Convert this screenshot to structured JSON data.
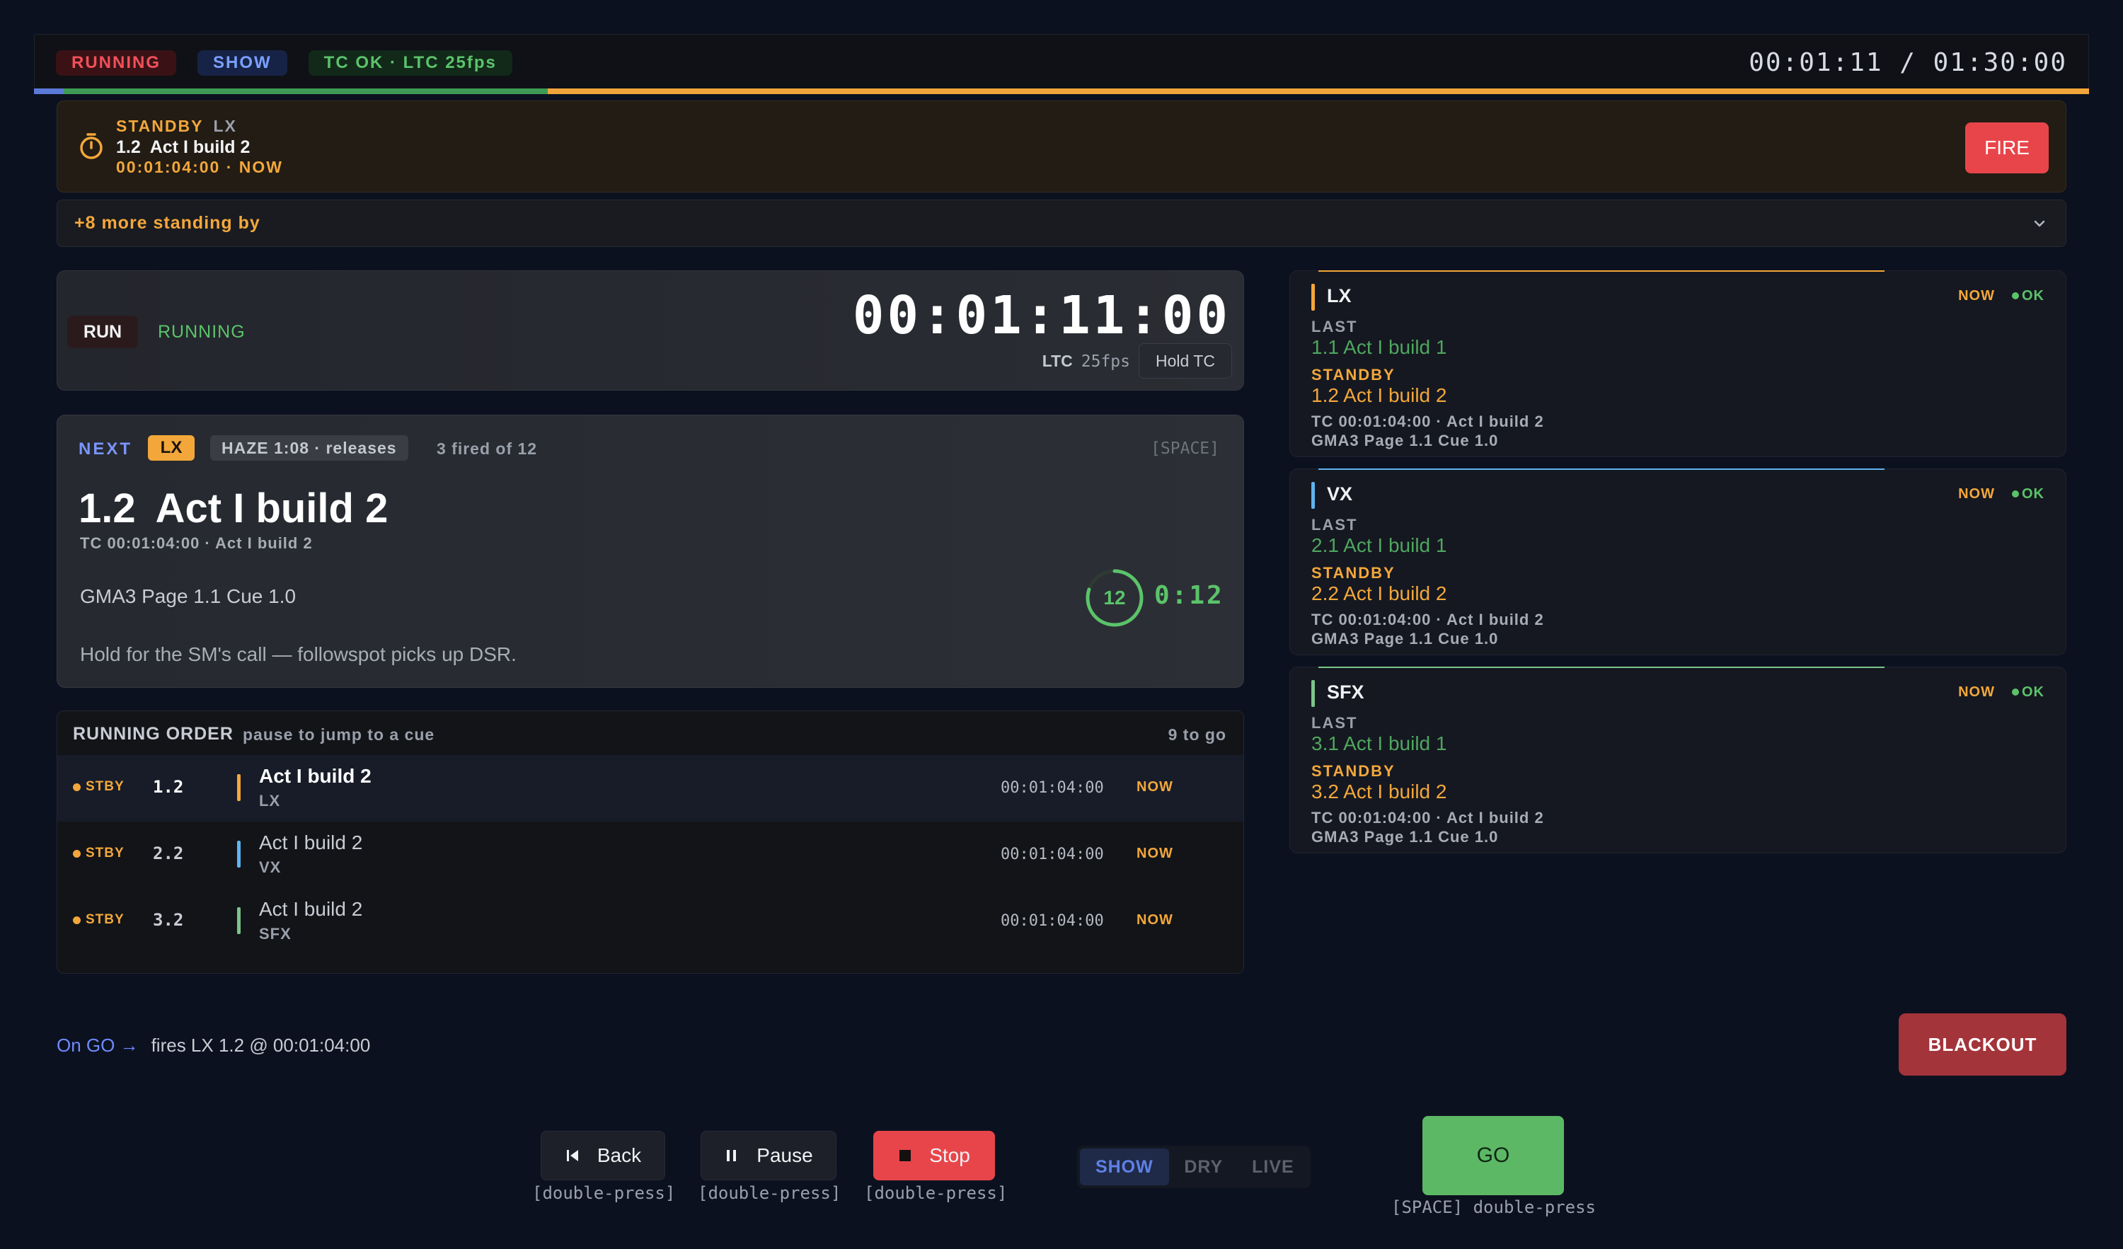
{
  "status_bar": {
    "running": "RUNNING",
    "mode": "SHOW",
    "tc_status": "TC OK · LTC 25fps",
    "elapsed_total": "00:01:11 / 01:30:00"
  },
  "colors": {
    "amber": "#f3a73b",
    "green": "#5bc36a",
    "red": "#e8454a",
    "blue": "#7a95ff",
    "vx": "#5fb3f0",
    "sfx": "#7cc48a"
  },
  "standby": {
    "label": "STANDBY",
    "dept": "LX",
    "cue": "1.2  Act I build 2",
    "time": "00:01:04:00 · NOW",
    "fire_label": "FIRE",
    "icon": "stopwatch-icon"
  },
  "more_standby": {
    "label": "+8 more standing by",
    "icon": "chevron-down-icon"
  },
  "timecode": {
    "run_label": "RUN",
    "status": "RUNNING",
    "tc": "00:01:11:00",
    "ltc_label": "LTC",
    "fps": "25fps",
    "hold_label": "Hold TC"
  },
  "next": {
    "label": "NEXT",
    "dept": "LX",
    "haze": "HAZE 1:08 · releases",
    "fired": "3 fired of 12",
    "shortcut": "[SPACE]",
    "number": "1.2",
    "title": "Act I build 2",
    "tc_line": "TC 00:01:04:00 · Act I build 2",
    "target": "GMA3 Page 1.1 Cue 1.0",
    "note": "Hold for the SM's call — followspot picks up DSR.",
    "countdown_num": "12",
    "countdown_time": "0:12",
    "countdown_fraction": 0.8
  },
  "running_order": {
    "title": "RUNNING ORDER",
    "subtitle": "pause to jump to a cue",
    "remaining": "9 to go",
    "rows": [
      {
        "status": "STBY",
        "num": "1.2",
        "title": "Act I build 2",
        "dept": "LX",
        "tc": "00:01:04:00",
        "when": "NOW",
        "color": "#f3a73b"
      },
      {
        "status": "STBY",
        "num": "2.2",
        "title": "Act I build 2",
        "dept": "VX",
        "tc": "00:01:04:00",
        "when": "NOW",
        "color": "#5fb3f0"
      },
      {
        "status": "STBY",
        "num": "3.2",
        "title": "Act I build 2",
        "dept": "SFX",
        "tc": "00:01:04:00",
        "when": "NOW",
        "color": "#7cc48a"
      }
    ]
  },
  "dept_cards": [
    {
      "name": "LX",
      "now": "NOW",
      "ok": "OK",
      "last_label": "LAST",
      "last": "1.1 Act I build 1",
      "standby_label": "STANDBY",
      "standby": "1.2 Act I build 2",
      "tc_line": "TC 00:01:04:00 · Act I build 2",
      "target": "GMA3 Page 1.1 Cue 1.0",
      "color": "#f3a73b"
    },
    {
      "name": "VX",
      "now": "NOW",
      "ok": "OK",
      "last_label": "LAST",
      "last": "2.1 Act I build 1",
      "standby_label": "STANDBY",
      "standby": "2.2 Act I build 2",
      "tc_line": "TC 00:01:04:00 · Act I build 2",
      "target": "GMA3 Page 1.1 Cue 1.0",
      "color": "#5fb3f0"
    },
    {
      "name": "SFX",
      "now": "NOW",
      "ok": "OK",
      "last_label": "LAST",
      "last": "3.1 Act I build 1",
      "standby_label": "STANDBY",
      "standby": "3.2 Act I build 2",
      "tc_line": "TC 00:01:04:00 · Act I build 2",
      "target": "GMA3 Page 1.1 Cue 1.0",
      "color": "#7cc48a"
    }
  ],
  "on_go": {
    "label": "On GO →",
    "text": "fires LX 1.2 @ 00:01:04:00"
  },
  "blackout_label": "BLACKOUT",
  "controls": {
    "back": "Back",
    "pause": "Pause",
    "stop": "Stop",
    "double_press": "[double-press]",
    "modes": [
      "SHOW",
      "DRY",
      "LIVE"
    ],
    "active_mode": "SHOW",
    "go": "GO",
    "go_hint": "[SPACE] double-press"
  }
}
